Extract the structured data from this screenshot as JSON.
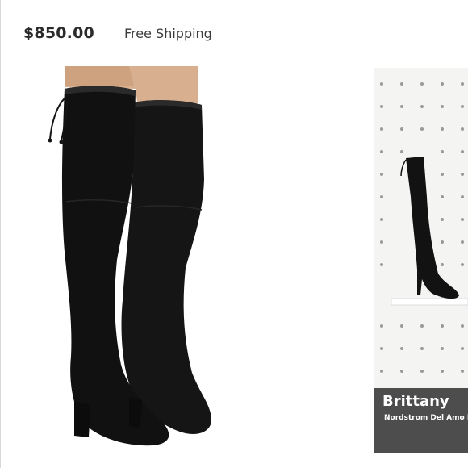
{
  "listing": {
    "price": "$850.00",
    "shipping": "Free Shipping"
  },
  "main_image": {
    "subject": "black-suede-over-the-knee-boots-icon"
  },
  "thumbnail": {
    "name": "Brittany",
    "store": "Nordstrom Del Amo Fashion"
  },
  "colors": {
    "boot": "#141414",
    "skin": "#d9b08f",
    "pegboard": "#f4f4f2",
    "band": "#282828"
  }
}
